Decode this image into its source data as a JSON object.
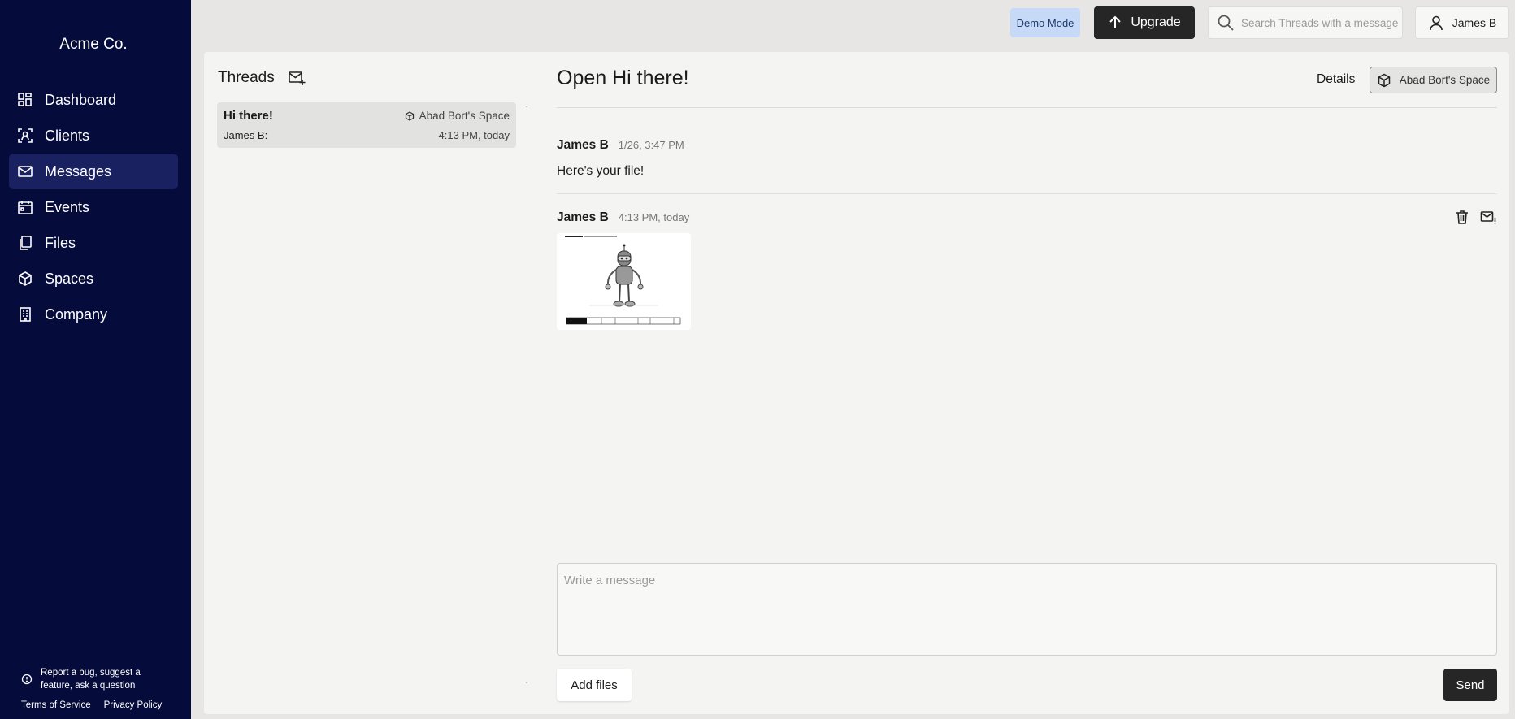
{
  "sidebar": {
    "brand": "Acme Co.",
    "items": [
      {
        "label": "Dashboard",
        "icon": "dashboard-icon"
      },
      {
        "label": "Clients",
        "icon": "clients-icon"
      },
      {
        "label": "Messages",
        "icon": "envelope-icon",
        "active": true
      },
      {
        "label": "Events",
        "icon": "calendar-icon"
      },
      {
        "label": "Files",
        "icon": "files-icon"
      },
      {
        "label": "Spaces",
        "icon": "cube-icon"
      },
      {
        "label": "Company",
        "icon": "building-icon"
      }
    ],
    "help_text_line1": "Report a bug, suggest a",
    "help_text_line2": "feature, ask a question",
    "terms_label": "Terms of Service",
    "privacy_label": "Privacy Policy"
  },
  "topbar": {
    "demo_badge": "Demo Mode",
    "upgrade_label": "Upgrade",
    "search_placeholder": "Search Threads with a message",
    "user_name": "James B"
  },
  "threads": {
    "title": "Threads",
    "items": [
      {
        "subject": "Hi there!",
        "space": "Abad Bort's Space",
        "last_author": "James B:",
        "time": "4:13 PM, today"
      }
    ]
  },
  "conversation": {
    "title": "Open Hi there!",
    "details_label": "Details",
    "space_label": "Abad Bort's Space",
    "messages": [
      {
        "author": "James B",
        "time": "1/26, 3:47 PM",
        "text": "Here's your file!"
      },
      {
        "author": "James B",
        "time": "4:13 PM, today",
        "attachment": "robot-drawing-thumbnail"
      }
    ],
    "composer_placeholder": "Write a message",
    "add_files_label": "Add files",
    "send_label": "Send"
  },
  "colors": {
    "sidebar_bg": "#050c3b",
    "sidebar_active": "#1a2161",
    "demo_badge_bg": "#c6daf8",
    "primary_button": "#262626"
  }
}
